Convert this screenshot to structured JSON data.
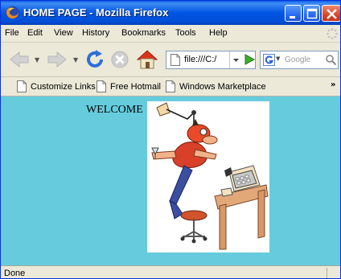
{
  "window": {
    "title": "HOME PAGE - Mozilla Firefox"
  },
  "menu": [
    "File",
    "Edit",
    "View",
    "History",
    "Bookmarks",
    "Tools",
    "Help"
  ],
  "navigation": {
    "url": "file:///C:/",
    "search_placeholder": "Google"
  },
  "bookmarks": [
    "Customize Links",
    "Free Hotmail",
    "Windows Marketplace"
  ],
  "bookmarks_overflow": "»",
  "content": {
    "heading": "WELCOME"
  },
  "status": {
    "text": "Done"
  },
  "colors": {
    "titlebar": "#0054e3",
    "chrome": "#ece9d8",
    "page_background": "#66ccdd"
  },
  "icons": {
    "app": "firefox-icon",
    "back": "back-arrow-icon",
    "forward": "forward-arrow-icon",
    "reload": "reload-icon",
    "stop": "stop-icon",
    "home": "home-icon",
    "go": "go-arrow-icon",
    "search_engine": "google-icon",
    "search": "magnifier-icon",
    "page": "page-icon"
  }
}
